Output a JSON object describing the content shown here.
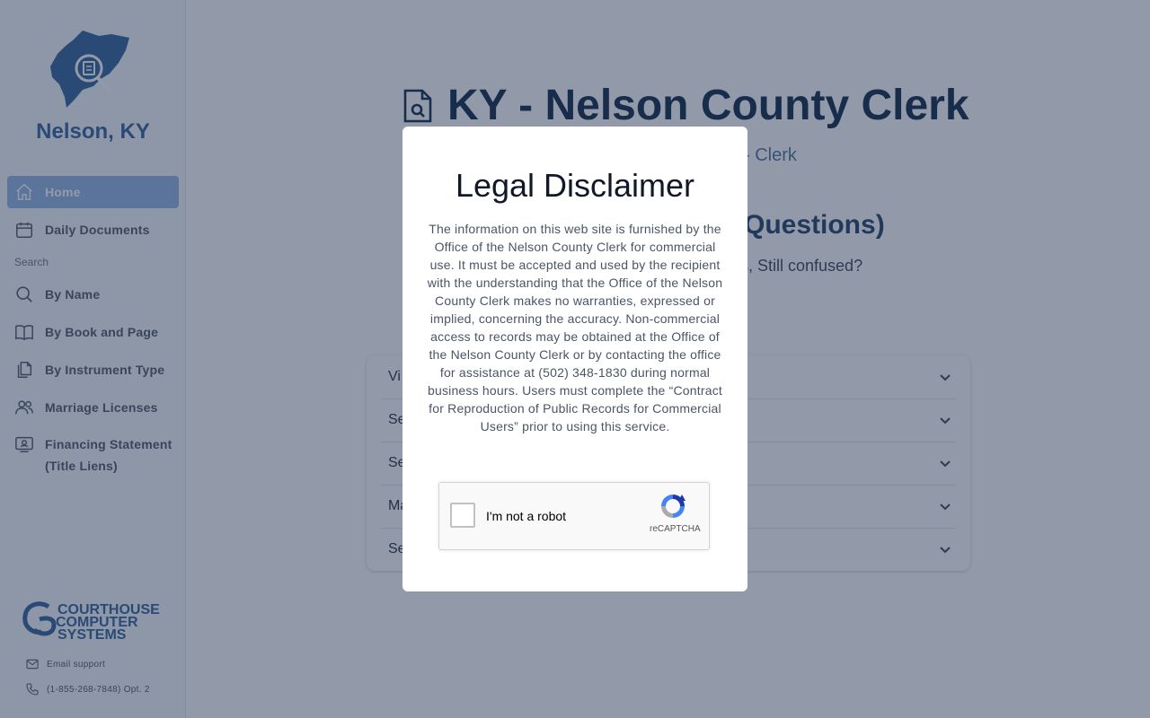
{
  "sidebar": {
    "county_name": "Nelson, KY",
    "items": [
      {
        "label": "Home",
        "icon": "home-icon"
      },
      {
        "label": "Daily Documents",
        "icon": "calendar-icon"
      },
      {
        "label": "By Name",
        "icon": "search-icon"
      },
      {
        "label": "By Book and Page",
        "icon": "book-icon"
      },
      {
        "label": "By Instrument Type",
        "icon": "documents-icon"
      },
      {
        "label": "Marriage Licenses",
        "icon": "users-icon"
      },
      {
        "label": "Financing Statement",
        "label_line2": "(Title Liens)",
        "icon": "id-card-icon"
      }
    ],
    "search_section_label": "Search",
    "vendor_logo_text": [
      "COURTHOUSE",
      "COMPUTER",
      "SYSTEMS"
    ],
    "email_support": "Email support",
    "phone_support": "(1-855-268-7848) Opt. 2"
  },
  "main": {
    "title": "KY - Nelson County Clerk",
    "subtitle_fragment": "- Clerk",
    "faq_title_fragment": "Questions)",
    "faq_sub_fragment": "ns, Still confused?",
    "faq_sub2_fragment": ".",
    "accordion": [
      {
        "label_fragment": "Vi"
      },
      {
        "label_fragment": "Se"
      },
      {
        "label_fragment": "Se"
      },
      {
        "label_fragment": "Ma"
      },
      {
        "label_fragment": "Se"
      }
    ]
  },
  "modal": {
    "title": "Legal Disclaimer",
    "body": "The information on this web site is furnished by the Office of the Nelson County Clerk for commercial use. It must be accepted and used by the recipient with the understanding that the Office of the Nelson County Clerk makes no warranties, expressed or implied, concerning the accuracy. Non-commercial access to records may be obtained at the Office of the Nelson County Clerk or by contacting the office for assistance at (502) 348-1830 during normal business hours. Users must complete the “Contract for Reproduction of Public Records for Commercial Users” prior to using this service.",
    "captcha_label": "I'm not a robot",
    "captcha_brand": "reCAPTCHA"
  },
  "colors": {
    "primary": "#2e5f98",
    "active_nav": "#8fb3e3",
    "title": "#0b2545",
    "overlay": "rgba(37,54,84,0.5)"
  }
}
